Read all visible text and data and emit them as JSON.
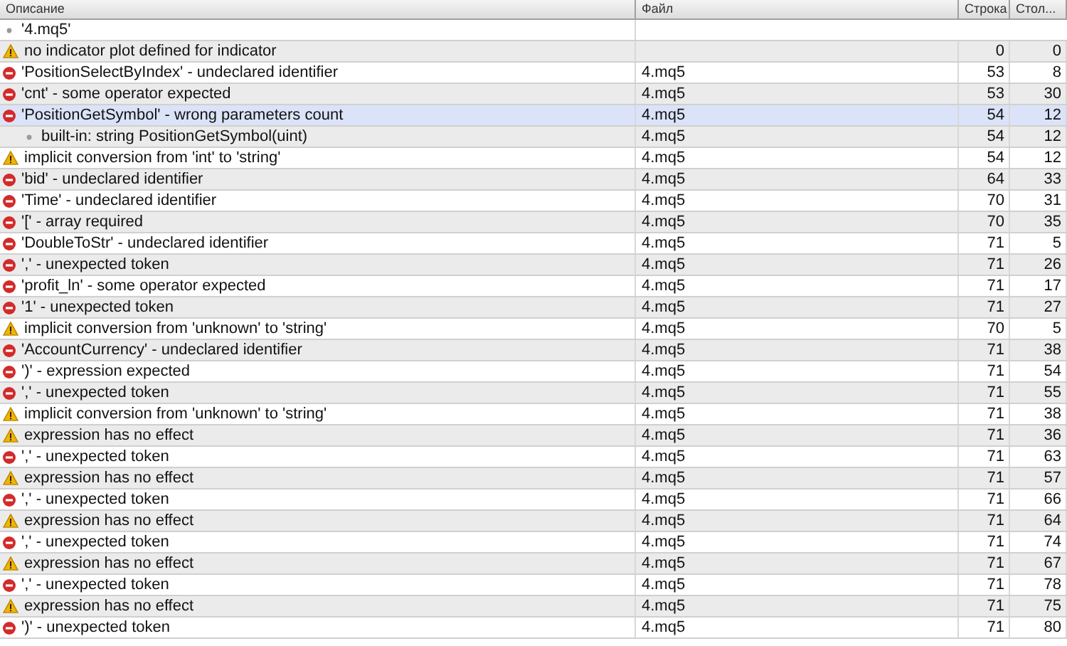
{
  "columns": [
    "Описание",
    "Файл",
    "Строка",
    "Стол..."
  ],
  "rows": [
    {
      "kind": "info",
      "text": "'4.mq5'",
      "selected": false
    },
    {
      "kind": "warning",
      "text": "no indicator plot defined for indicator",
      "file": "",
      "line": "0",
      "column": "0",
      "selected": false
    },
    {
      "kind": "error",
      "text": "'PositionSelectByIndex' - undeclared identifier",
      "file": "4.mq5",
      "line": "53",
      "column": "8",
      "selected": false
    },
    {
      "kind": "error",
      "text": "'cnt' - some operator expected",
      "file": "4.mq5",
      "line": "53",
      "column": "30",
      "selected": false
    },
    {
      "kind": "error",
      "text": "'PositionGetSymbol' - wrong parameters count",
      "file": "4.mq5",
      "line": "54",
      "column": "12",
      "selected": true,
      "children": [
        {
          "kind": "info",
          "text": "built-in: string PositionGetSymbol(uint)",
          "file": "4.mq5",
          "line": "54",
          "column": "12",
          "selected": false
        }
      ]
    },
    {
      "kind": "warning",
      "text": "implicit conversion from 'int' to 'string'",
      "file": "4.mq5",
      "line": "54",
      "column": "12",
      "selected": false
    },
    {
      "kind": "error",
      "text": "'bid' - undeclared identifier",
      "file": "4.mq5",
      "line": "64",
      "column": "33",
      "selected": false
    },
    {
      "kind": "error",
      "text": "'Time' - undeclared identifier",
      "file": "4.mq5",
      "line": "70",
      "column": "31",
      "selected": false
    },
    {
      "kind": "error",
      "text": "'[' - array required",
      "file": "4.mq5",
      "line": "70",
      "column": "35",
      "selected": false
    },
    {
      "kind": "error",
      "text": "'DoubleToStr' - undeclared identifier",
      "file": "4.mq5",
      "line": "71",
      "column": "5",
      "selected": false
    },
    {
      "kind": "error",
      "text": "',' - unexpected token",
      "file": "4.mq5",
      "line": "71",
      "column": "26",
      "selected": false
    },
    {
      "kind": "error",
      "text": "'profit_ln' - some operator expected",
      "file": "4.mq5",
      "line": "71",
      "column": "17",
      "selected": false
    },
    {
      "kind": "error",
      "text": "'1' - unexpected token",
      "file": "4.mq5",
      "line": "71",
      "column": "27",
      "selected": false
    },
    {
      "kind": "warning",
      "text": "implicit conversion from 'unknown' to 'string'",
      "file": "4.mq5",
      "line": "70",
      "column": "5",
      "selected": false
    },
    {
      "kind": "error",
      "text": "'AccountCurrency' - undeclared identifier",
      "file": "4.mq5",
      "line": "71",
      "column": "38",
      "selected": false
    },
    {
      "kind": "error",
      "text": "')' - expression expected",
      "file": "4.mq5",
      "line": "71",
      "column": "54",
      "selected": false
    },
    {
      "kind": "error",
      "text": "',' - unexpected token",
      "file": "4.mq5",
      "line": "71",
      "column": "55",
      "selected": false
    },
    {
      "kind": "warning",
      "text": "implicit conversion from 'unknown' to 'string'",
      "file": "4.mq5",
      "line": "71",
      "column": "38",
      "selected": false
    },
    {
      "kind": "warning",
      "text": "expression has no effect",
      "file": "4.mq5",
      "line": "71",
      "column": "36",
      "selected": false
    },
    {
      "kind": "error",
      "text": "',' - unexpected token",
      "file": "4.mq5",
      "line": "71",
      "column": "63",
      "selected": false
    },
    {
      "kind": "warning",
      "text": "expression has no effect",
      "file": "4.mq5",
      "line": "71",
      "column": "57",
      "selected": false
    },
    {
      "kind": "error",
      "text": "',' - unexpected token",
      "file": "4.mq5",
      "line": "71",
      "column": "66",
      "selected": false
    },
    {
      "kind": "warning",
      "text": "expression has no effect",
      "file": "4.mq5",
      "line": "71",
      "column": "64",
      "selected": false
    },
    {
      "kind": "error",
      "text": "',' - unexpected token",
      "file": "4.mq5",
      "line": "71",
      "column": "74",
      "selected": false
    },
    {
      "kind": "warning",
      "text": "expression has no effect",
      "file": "4.mq5",
      "line": "71",
      "column": "67",
      "selected": false
    },
    {
      "kind": "error",
      "text": "',' - unexpected token",
      "file": "4.mq5",
      "line": "71",
      "column": "78",
      "selected": false
    },
    {
      "kind": "warning",
      "text": "expression has no effect",
      "file": "4.mq5",
      "line": "71",
      "column": "75",
      "selected": false
    },
    {
      "kind": "error",
      "text": "')' - unexpected token",
      "file": "4.mq5",
      "line": "71",
      "column": "80",
      "selected": false
    }
  ]
}
